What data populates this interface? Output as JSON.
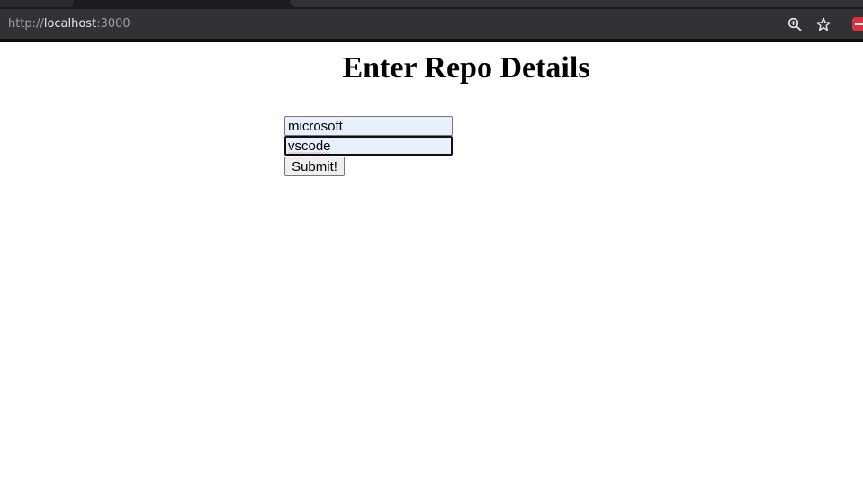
{
  "browser": {
    "url_scheme": "http://",
    "url_host": "localhost",
    "url_port": ":3000",
    "zoom_icon": "zoom-in-icon",
    "bookmark_icon": "star-icon",
    "extension_icon": "extension-icon"
  },
  "page": {
    "title": "Enter Repo Details"
  },
  "form": {
    "owner_value": "microsoft",
    "repo_value": "vscode",
    "submit_label": "Submit!"
  },
  "colors": {
    "browser_chrome": "#323236",
    "autofill_background": "#e8f0fe",
    "spellcheck_underline": "#e23b3b"
  }
}
